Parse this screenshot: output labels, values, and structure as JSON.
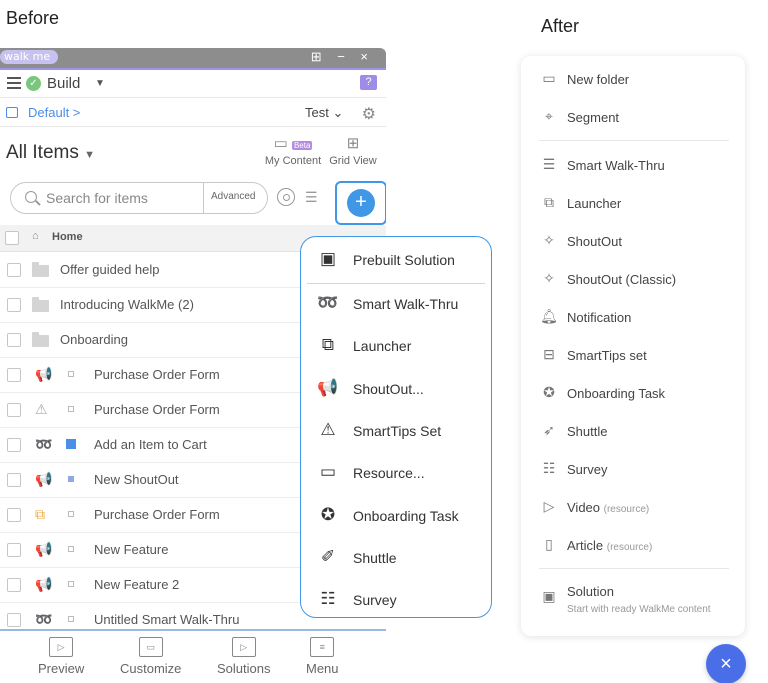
{
  "labels": {
    "before": "Before",
    "after": "After"
  },
  "before": {
    "logo": "walk me",
    "window_buttons": "⊞ − ×",
    "build": "Build",
    "help_badge": "?",
    "breadcrumb": "Default  >",
    "environment": "Test",
    "title": "All Items",
    "tools": {
      "my_content": "My Content",
      "beta": "Beta",
      "grid_view": "Grid View"
    },
    "search": {
      "placeholder": "Search for items",
      "advanced": "Advanced"
    },
    "home": "Home",
    "folders": [
      "Offer guided help",
      "Introducing WalkMe (2)",
      "Onboarding"
    ],
    "items": [
      {
        "name": "Purchase Order Form",
        "icon": "shoutout-icon"
      },
      {
        "name": "Purchase Order Form",
        "icon": "smarttips-icon"
      },
      {
        "name": "Add an Item to Cart",
        "icon": "smart-walkthru-icon"
      },
      {
        "name": "New ShoutOut",
        "icon": "shoutout-icon"
      },
      {
        "name": "Purchase Order Form",
        "icon": "launcher-icon"
      },
      {
        "name": "New Feature",
        "icon": "shoutout-icon"
      },
      {
        "name": "New Feature 2",
        "icon": "shoutout-icon"
      },
      {
        "name": "Untitled Smart Walk-Thru",
        "icon": "smart-walkthru-icon"
      }
    ],
    "bottom_tabs": [
      "Preview",
      "Customize",
      "Solutions",
      "Menu"
    ],
    "dropdown": [
      "Prebuilt Solution",
      "Smart Walk-Thru",
      "Launcher",
      "ShoutOut...",
      "SmartTips Set",
      "Resource...",
      "Onboarding Task",
      "Shuttle",
      "Survey"
    ]
  },
  "after": {
    "items": [
      {
        "label": "New folder"
      },
      {
        "label": "Segment"
      },
      {
        "label": "Smart Walk-Thru"
      },
      {
        "label": "Launcher"
      },
      {
        "label": "ShoutOut"
      },
      {
        "label": "ShoutOut (Classic)"
      },
      {
        "label": "Notification"
      },
      {
        "label": "SmartTips set"
      },
      {
        "label": "Onboarding Task"
      },
      {
        "label": "Shuttle"
      },
      {
        "label": "Survey"
      },
      {
        "label": "Video",
        "sub": "(resource)"
      },
      {
        "label": "Article",
        "sub": "(resource)"
      },
      {
        "label": "Solution"
      }
    ],
    "solution_sub": "Start with ready WalkMe content",
    "close": "×"
  },
  "colors": {
    "accent_blue": "#3f97e6",
    "close_blue": "#4a6ee8",
    "shoutout_orange": "#f0a63c",
    "build_green": "#7bc67e"
  }
}
